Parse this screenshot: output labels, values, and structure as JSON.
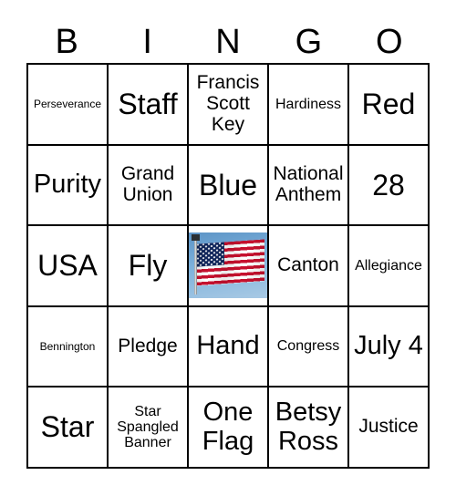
{
  "card": {
    "header_letters": [
      "B",
      "I",
      "N",
      "G",
      "O"
    ],
    "rows": [
      [
        {
          "text": "Perseverance",
          "size": "xs",
          "type": "text"
        },
        {
          "text": "Staff",
          "size": "xl",
          "type": "text"
        },
        {
          "text": "Francis Scott Key",
          "size": "md",
          "type": "text"
        },
        {
          "text": "Hardiness",
          "size": "sm",
          "type": "text"
        },
        {
          "text": "Red",
          "size": "xl",
          "type": "text"
        }
      ],
      [
        {
          "text": "Purity",
          "size": "lg",
          "type": "text"
        },
        {
          "text": "Grand Union",
          "size": "md",
          "type": "text"
        },
        {
          "text": "Blue",
          "size": "xl",
          "type": "text"
        },
        {
          "text": "National Anthem",
          "size": "md",
          "type": "text"
        },
        {
          "text": "28",
          "size": "xl",
          "type": "text"
        }
      ],
      [
        {
          "text": "USA",
          "size": "xl",
          "type": "text"
        },
        {
          "text": "Fly",
          "size": "xl",
          "type": "text"
        },
        {
          "text": "",
          "size": "md",
          "type": "image",
          "image_name": "american-flag-photo"
        },
        {
          "text": "Canton",
          "size": "md",
          "type": "text"
        },
        {
          "text": "Allegiance",
          "size": "sm",
          "type": "text"
        }
      ],
      [
        {
          "text": "Bennington",
          "size": "xs",
          "type": "text"
        },
        {
          "text": "Pledge",
          "size": "md",
          "type": "text"
        },
        {
          "text": "Hand",
          "size": "lg",
          "type": "text"
        },
        {
          "text": "Congress",
          "size": "sm",
          "type": "text"
        },
        {
          "text": "July 4",
          "size": "lg",
          "type": "text"
        }
      ],
      [
        {
          "text": "Star",
          "size": "xl",
          "type": "text"
        },
        {
          "text": "Star Spangled Banner",
          "size": "sm",
          "type": "text"
        },
        {
          "text": "One Flag",
          "size": "lg",
          "type": "text"
        },
        {
          "text": "Betsy Ross",
          "size": "lg",
          "type": "text"
        },
        {
          "text": "Justice",
          "size": "md",
          "type": "text"
        }
      ]
    ]
  },
  "colors": {
    "border": "#000000",
    "background": "#ffffff",
    "text": "#000000",
    "flag_red": "#c8102e",
    "flag_blue": "#10265c",
    "sky_blue": "#7db2dc"
  }
}
